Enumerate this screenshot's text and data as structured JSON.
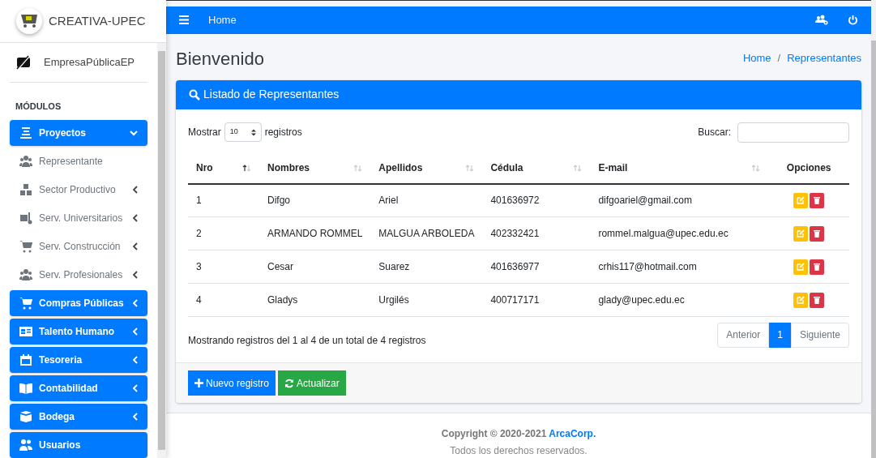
{
  "sidebar": {
    "brand": "CREATIVA-UPEC",
    "user": "EmpresaPúblicaEP",
    "section_label": "MÓDULOS",
    "items": [
      {
        "label": "Proyectos",
        "kind": "main",
        "expanded": true
      },
      {
        "label": "Representante",
        "kind": "sub"
      },
      {
        "label": "Sector Productivo",
        "kind": "sub",
        "expanded": false
      },
      {
        "label": "Serv. Universitarios",
        "kind": "sub",
        "expanded": false
      },
      {
        "label": "Serv. Construcción",
        "kind": "sub",
        "expanded": false
      },
      {
        "label": "Serv. Profesionales",
        "kind": "sub",
        "expanded": false
      },
      {
        "label": "Compras Públicas",
        "kind": "main",
        "expanded": false
      },
      {
        "label": "Talento Humano",
        "kind": "main",
        "expanded": false
      },
      {
        "label": "Tesoreria",
        "kind": "main",
        "expanded": false
      },
      {
        "label": "Contabilidad",
        "kind": "main",
        "expanded": false
      },
      {
        "label": "Bodega",
        "kind": "main",
        "expanded": false
      },
      {
        "label": "Usuarios",
        "kind": "main"
      }
    ]
  },
  "navbar": {
    "link": "Home"
  },
  "page": {
    "title": "Bienvenido",
    "breadcrumb": [
      "Home",
      "Representantes"
    ],
    "breadcrumb_separator": "/"
  },
  "card": {
    "title": "Listado de Representantes",
    "length": {
      "before": "Mostrar",
      "value": "10",
      "after": "registros"
    },
    "search": {
      "label": "Buscar:"
    },
    "table": {
      "columns": [
        {
          "label": "Nro",
          "kind": "sortable",
          "sorted": true
        },
        {
          "label": "Nombres",
          "kind": "sortable",
          "sorted": false
        },
        {
          "label": "Apellidos",
          "kind": "sortable",
          "sorted": false
        },
        {
          "label": "Cédula",
          "kind": "sortable",
          "sorted": false
        },
        {
          "label": "E-mail",
          "kind": "sortable",
          "sorted": false
        },
        {
          "label": "Opciones",
          "kind": "plain"
        }
      ],
      "rows": [
        [
          "1",
          "Difgo",
          "Ariel",
          "401636972",
          "difgoariel@gmail.com"
        ],
        [
          "2",
          "ARMANDO ROMMEL",
          "MALGUA ARBOLEDA",
          "402332421",
          "rommel.malgua@upec.edu.ec"
        ],
        [
          "3",
          "Cesar",
          "Suarez",
          "401636977",
          "crhis117@hotmail.com"
        ],
        [
          "4",
          "Gladys",
          "Urgilés",
          "400717171",
          "glady@upec.edu.ec"
        ]
      ]
    },
    "info": "Mostrando registros del 1 al 4 de un total de 4 registros",
    "pagination": {
      "previous": {
        "label": "Anterior",
        "disabled": true
      },
      "pages": [
        {
          "label": "1",
          "selected": true
        }
      ],
      "next": {
        "label": "Siguiente",
        "disabled": true
      }
    },
    "buttons": [
      {
        "label": "Nuevo registro",
        "kind": "new"
      },
      {
        "label": "Actualizar",
        "kind": "refresh"
      }
    ]
  },
  "footer": {
    "copyright": "Copyright © 2020-2021",
    "company": "ArcaCorp.",
    "rights": "Todos los derechos reservados."
  }
}
